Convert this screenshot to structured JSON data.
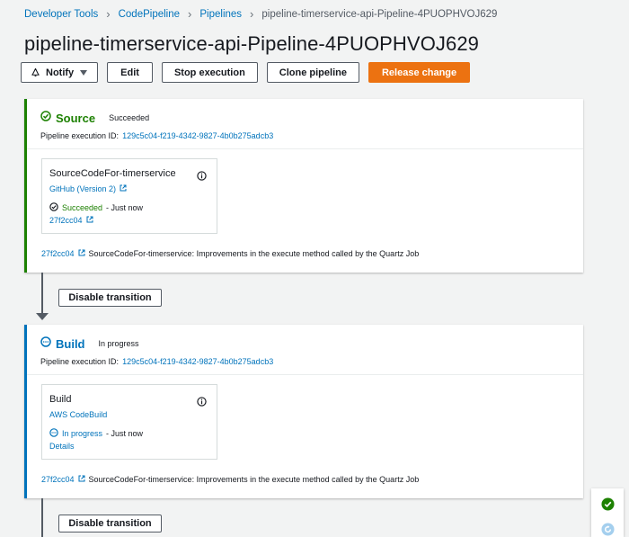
{
  "breadcrumb": {
    "items": [
      "Developer Tools",
      "CodePipeline",
      "Pipelines"
    ],
    "current": "pipeline-timerservice-api-Pipeline-4PUOPHVOJ629"
  },
  "page_title": "pipeline-timerservice-api-Pipeline-4PUOPHVOJ629",
  "toolbar": {
    "notify": "Notify",
    "edit": "Edit",
    "stop": "Stop execution",
    "clone": "Clone pipeline",
    "release": "Release change"
  },
  "stages": {
    "source": {
      "name": "Source",
      "status": "Succeeded",
      "exec_label": "Pipeline execution ID:",
      "exec_id": "129c5c04-f219-4342-9827-4b0b275adcb3",
      "action": {
        "title": "SourceCodeFor-timerservice",
        "provider": "GitHub (Version 2)",
        "state": "Succeeded",
        "state_suffix": "- Just now",
        "sub_link": "27f2cc04"
      },
      "commit_id": "27f2cc04",
      "commit_msg": "SourceCodeFor-timerservice: Improvements in the execute method called by the Quartz Job"
    },
    "build": {
      "name": "Build",
      "status": "In progress",
      "exec_label": "Pipeline execution ID:",
      "exec_id": "129c5c04-f219-4342-9827-4b0b275adcb3",
      "action": {
        "title": "Build",
        "provider": "AWS CodeBuild",
        "state": "In progress",
        "state_suffix": "- Just now",
        "sub_link": "Details"
      },
      "commit_id": "27f2cc04",
      "commit_msg": "SourceCodeFor-timerservice: Improvements in the execute method called by the Quartz Job"
    }
  },
  "transitions": {
    "label": "Disable transition"
  },
  "colors": {
    "success": "#1d8102",
    "progress": "#0073bb",
    "primary_button": "#ec7211",
    "link": "#0073bb"
  },
  "icons": [
    "bell-icon",
    "caret-down-icon",
    "check-circle-icon",
    "info-icon",
    "external-link-icon",
    "in-progress-icon",
    "arrow-down-icon",
    "refresh-icon"
  ]
}
